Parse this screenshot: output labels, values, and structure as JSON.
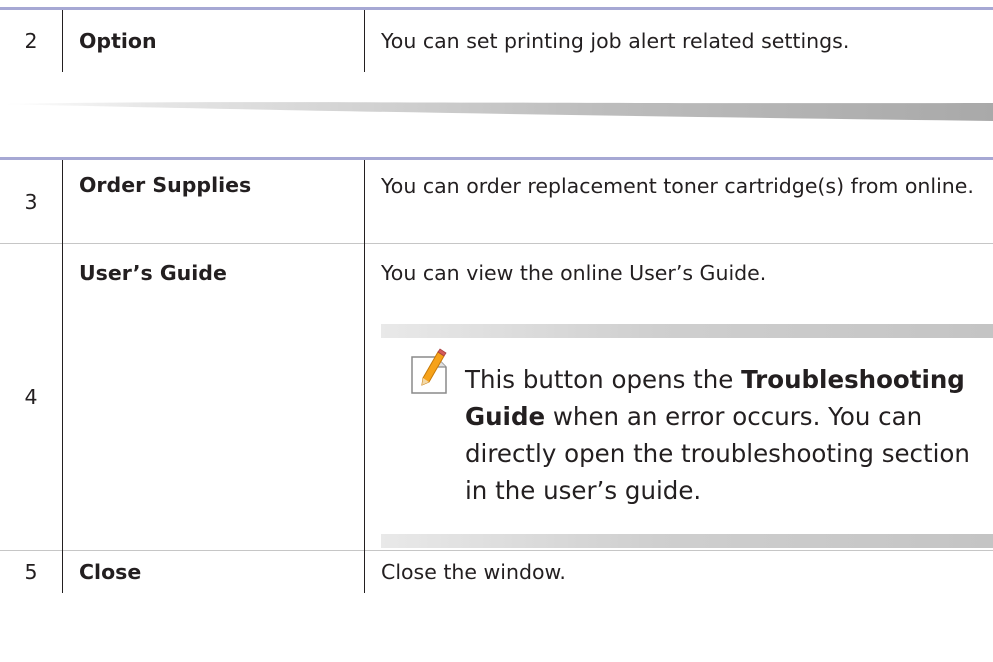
{
  "table1": {
    "rows": [
      {
        "num": "2",
        "name": "Option",
        "desc": "You can set printing job alert related settings."
      }
    ]
  },
  "table2": {
    "row3": {
      "num": "3",
      "name": "Order Supplies",
      "desc": "You can order replacement toner cartridge(s) from online."
    },
    "row4": {
      "num": "4",
      "name": "User’s Guide",
      "desc": "You can view the online User’s Guide.",
      "note": {
        "prefix": "This button opens the ",
        "bold": "Troubleshooting Guide",
        "suffix": " when an error occurs. You can directly open the troubleshooting section in the user’s guide."
      }
    },
    "row5": {
      "num": "5",
      "name": "Close",
      "desc": "Close the window."
    }
  },
  "icons": {
    "note": "note-pencil-icon"
  },
  "colors": {
    "table_top_bar": "#a6a8d4",
    "text": "#231f20"
  }
}
